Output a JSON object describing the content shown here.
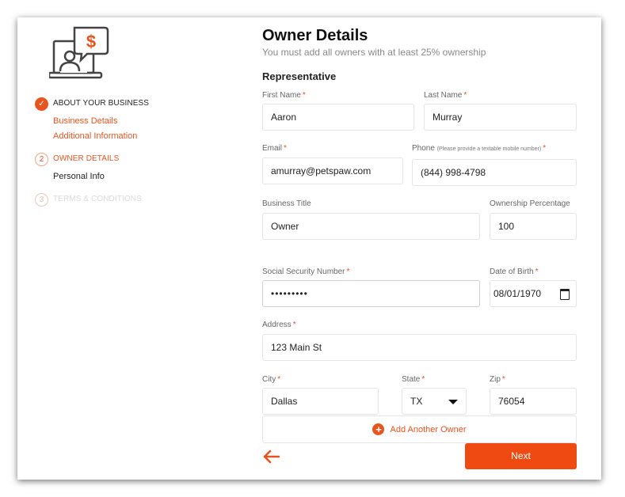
{
  "sidebar": {
    "steps": [
      {
        "number": "✓",
        "label": "ABOUT YOUR BUSINESS",
        "status": "done",
        "subitems": [
          "Business Details",
          "Additional Information"
        ]
      },
      {
        "number": "2",
        "label": "OWNER DETAILS",
        "status": "active",
        "subitems": [
          "Personal Info"
        ]
      },
      {
        "number": "3",
        "label": "TERMS & CONDITIONS",
        "status": "disabled",
        "subitems": []
      }
    ],
    "logo_icon": "person-with-dollar-speech-bubble-icon"
  },
  "main": {
    "title": "Owner Details",
    "subtitle": "You must add all owners with at least 25% ownership",
    "section": "Representative",
    "fields": {
      "first_name": {
        "label": "First Name",
        "required": "*",
        "value": "Aaron"
      },
      "last_name": {
        "label": "Last Name",
        "required": "*",
        "value": "Murray"
      },
      "email": {
        "label": "Email",
        "required": "*",
        "value": "amurray@petspaw.com"
      },
      "phone": {
        "label": "Phone",
        "hint": "(Please provide a textable mobile number)",
        "required": "*",
        "value": "(844) 998-4798"
      },
      "business_title": {
        "label": "Business Title",
        "value": "Owner"
      },
      "ownership": {
        "label": "Ownership Percentage",
        "value": "100"
      },
      "ssn": {
        "label": "Social Security Number",
        "required": "*",
        "value": "•••••••••"
      },
      "dob": {
        "label": "Date of Birth",
        "required": "*",
        "value": "08/01/1970"
      },
      "address": {
        "label": "Address",
        "required": "*",
        "value": "123 Main St"
      },
      "city": {
        "label": "City",
        "required": "*",
        "value": "Dallas"
      },
      "state": {
        "label": "State",
        "required": "*",
        "value": "TX"
      },
      "zip": {
        "label": "Zip",
        "required": "*",
        "value": "76054"
      }
    },
    "add_owner_label": "Add Another Owner",
    "next_label": "Next"
  },
  "colors": {
    "accent": "#e8541e",
    "button": "#ee4a12"
  }
}
